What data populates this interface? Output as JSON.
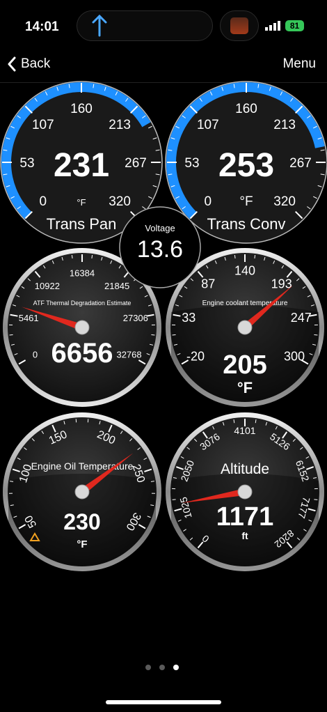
{
  "status": {
    "time": "14:01",
    "battery": "81"
  },
  "nav": {
    "back_label": "Back",
    "menu_label": "Menu"
  },
  "gauges": {
    "trans_pan": {
      "title": "Trans Pan",
      "value": "231",
      "unit": "°F",
      "ticks": [
        "0",
        "53",
        "107",
        "160",
        "213",
        "267",
        "320"
      ],
      "min": 0,
      "max": 320,
      "reading": 231
    },
    "trans_conv": {
      "title": "Trans Conv",
      "value": "253",
      "unit": "°F",
      "ticks": [
        "0",
        "53",
        "107",
        "160",
        "213",
        "267",
        "320"
      ],
      "min": 0,
      "max": 320,
      "reading": 253
    },
    "voltage": {
      "title": "Voltage",
      "value": "13.6"
    },
    "atf": {
      "title": "ATF Thermal Degradation Estimate",
      "value": "6656",
      "ticks": [
        "0",
        "5461",
        "10922",
        "16384",
        "21845",
        "27306",
        "32768"
      ],
      "min": 0,
      "max": 32768,
      "reading": 6656
    },
    "coolant": {
      "title": "Engine coolant temperature",
      "value": "205",
      "unit": "°F",
      "ticks": [
        "-20",
        "33",
        "87",
        "140",
        "193",
        "247",
        "300"
      ],
      "min": -20,
      "max": 300,
      "reading": 205
    },
    "oil": {
      "title": "Engine Oil Temperature",
      "value": "230",
      "unit": "°F",
      "ticks": [
        "50",
        "100",
        "150",
        "200",
        "250",
        "300"
      ],
      "min": 50,
      "max": 300,
      "reading": 230
    },
    "altitude": {
      "title": "Altitude",
      "value": "1171",
      "unit": "ft",
      "ticks": [
        "0",
        "1025",
        "2050",
        "3076",
        "4101",
        "5126",
        "6152",
        "7177",
        "8202"
      ],
      "min": 0,
      "max": 8202,
      "reading": 1171
    }
  },
  "colors": {
    "accent": "#1e90ff",
    "needle": "#e0281e",
    "battery": "#35c759"
  },
  "pager": {
    "pages": 3,
    "active": 3
  }
}
